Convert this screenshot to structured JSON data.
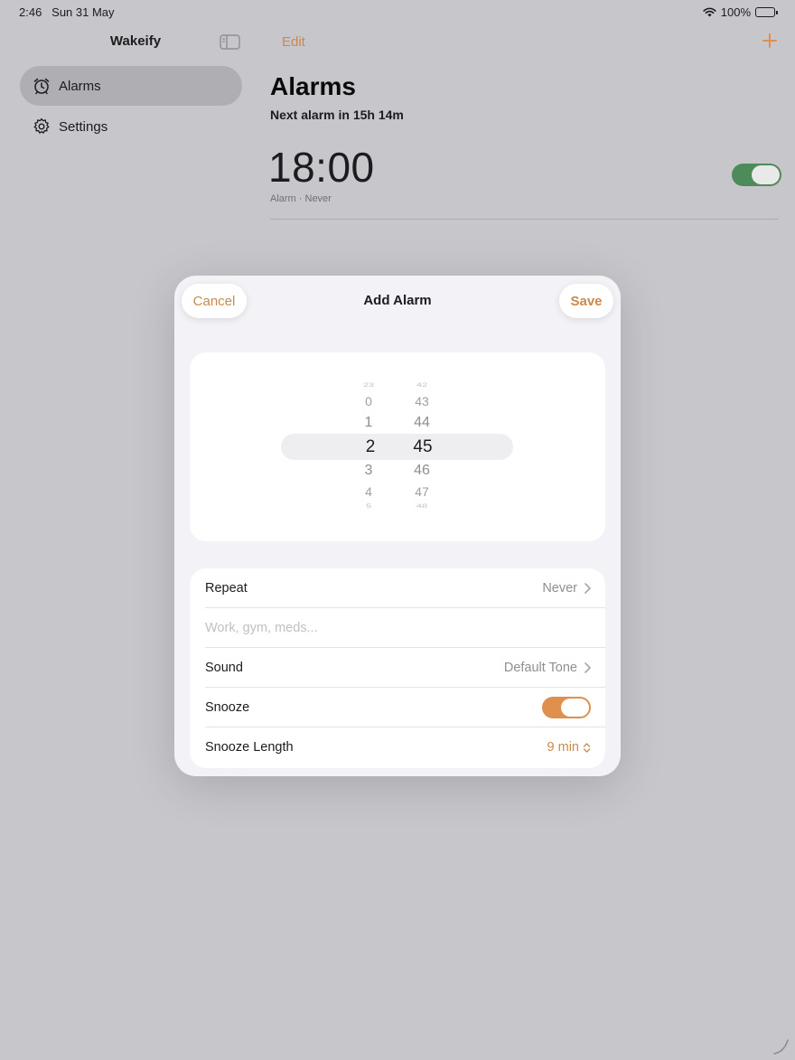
{
  "status": {
    "time": "2:46",
    "date": "Sun 31 May",
    "battery": "100%"
  },
  "sidebar": {
    "title": "Wakeify",
    "items": [
      {
        "label": "Alarms",
        "icon": "alarm-clock-icon",
        "selected": true
      },
      {
        "label": "Settings",
        "icon": "gear-icon",
        "selected": false
      }
    ]
  },
  "main": {
    "edit_label": "Edit",
    "title": "Alarms",
    "subtitle": "Next alarm in 15h 14m",
    "alarm": {
      "time": "18:00",
      "label": "Alarm · Never",
      "enabled": true
    }
  },
  "modal": {
    "cancel_label": "Cancel",
    "title": "Add Alarm",
    "save_label": "Save",
    "picker": {
      "hours": [
        "23",
        "0",
        "1",
        "2",
        "3",
        "4",
        "5"
      ],
      "minutes": [
        "42",
        "43",
        "44",
        "45",
        "46",
        "47",
        "48"
      ],
      "selected_hour": "2",
      "selected_minute": "45"
    },
    "form": {
      "repeat_label": "Repeat",
      "repeat_value": "Never",
      "name_placeholder": "Work, gym, meds...",
      "sound_label": "Sound",
      "sound_value": "Default Tone",
      "snooze_label": "Snooze",
      "snooze_on": true,
      "snooze_length_label": "Snooze Length",
      "snooze_length_value": "9 min"
    }
  },
  "colors": {
    "accent": "#c98a4b",
    "toggle_green": "#4e8b5a",
    "toggle_orange": "#e0904e"
  }
}
